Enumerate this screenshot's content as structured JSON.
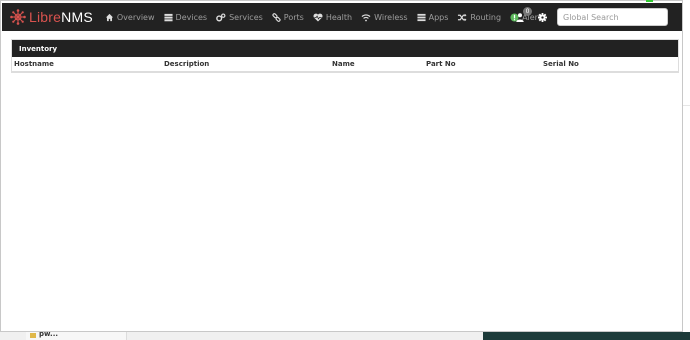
{
  "brand": {
    "logo_red": "Libre",
    "logo_white": "NMS",
    "accent": "#d9534f"
  },
  "nav": [
    {
      "label": "Overview",
      "icon": "home-icon"
    },
    {
      "label": "Devices",
      "icon": "server-icon"
    },
    {
      "label": "Services",
      "icon": "cogs-icon"
    },
    {
      "label": "Ports",
      "icon": "link-icon"
    },
    {
      "label": "Health",
      "icon": "heartbeat-icon"
    },
    {
      "label": "Wireless",
      "icon": "wifi-icon"
    },
    {
      "label": "Apps",
      "icon": "tasks-icon"
    },
    {
      "label": "Routing",
      "icon": "random-icon"
    },
    {
      "label": "Alerts",
      "icon": "exclamation-circle-icon"
    }
  ],
  "user": {
    "badge_count": "0"
  },
  "search": {
    "placeholder": "Global Search"
  },
  "panel": {
    "title": "Inventory",
    "columns": [
      "Hostname",
      "Description",
      "Name",
      "Part No",
      "Serial No"
    ]
  },
  "background": {
    "folder_label": "pw..."
  }
}
